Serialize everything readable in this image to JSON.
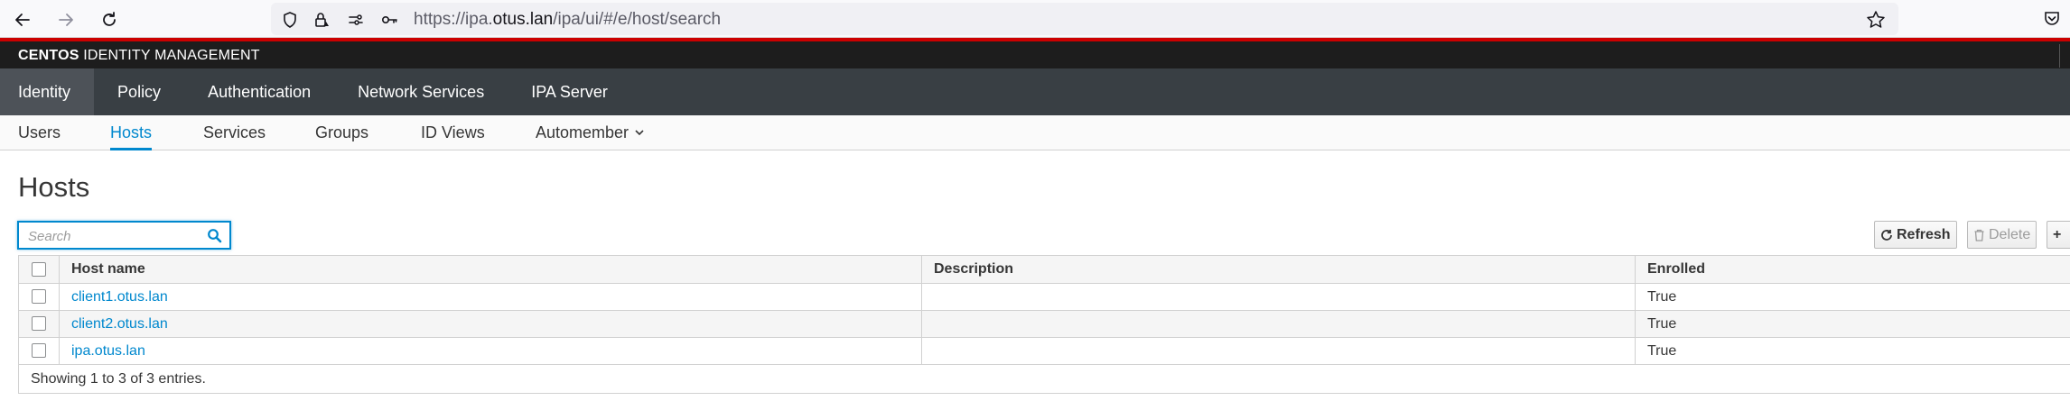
{
  "browser": {
    "url_prefix": "https://ipa.",
    "url_host": "otus.lan",
    "url_path": "/ipa/ui/#/e/host/search"
  },
  "masthead": {
    "brand_bold": "CENTOS",
    "brand_rest": " IDENTITY MANAGEMENT"
  },
  "primary_nav": {
    "items": [
      "Identity",
      "Policy",
      "Authentication",
      "Network Services",
      "IPA Server"
    ],
    "active": "Identity"
  },
  "secondary_nav": {
    "items": [
      "Users",
      "Hosts",
      "Services",
      "Groups",
      "ID Views",
      "Automember"
    ],
    "active": "Hosts"
  },
  "page": {
    "title": "Hosts",
    "search_placeholder": "Search"
  },
  "toolbar": {
    "refresh_label": "Refresh",
    "delete_label": "Delete",
    "add_label": "+"
  },
  "table": {
    "columns": [
      "Host name",
      "Description",
      "Enrolled"
    ],
    "rows": [
      {
        "host": "client1.otus.lan",
        "description": "",
        "enrolled": "True"
      },
      {
        "host": "client2.otus.lan",
        "description": "",
        "enrolled": "True"
      },
      {
        "host": "ipa.otus.lan",
        "description": "",
        "enrolled": "True"
      }
    ],
    "footer": "Showing 1 to 3 of 3 entries."
  },
  "colors": {
    "accent": "#0088ce",
    "masthead": "#1d1d1d",
    "primary_nav": "#393f44",
    "brand_red": "#cc0000"
  },
  "icons": [
    "back-icon",
    "forward-icon",
    "reload-icon",
    "shield-icon",
    "lock-icon",
    "permissions-icon",
    "key-icon",
    "bookmark-star-icon",
    "pocket-icon",
    "search-icon",
    "refresh-icon",
    "trash-icon",
    "chevron-down-icon"
  ]
}
